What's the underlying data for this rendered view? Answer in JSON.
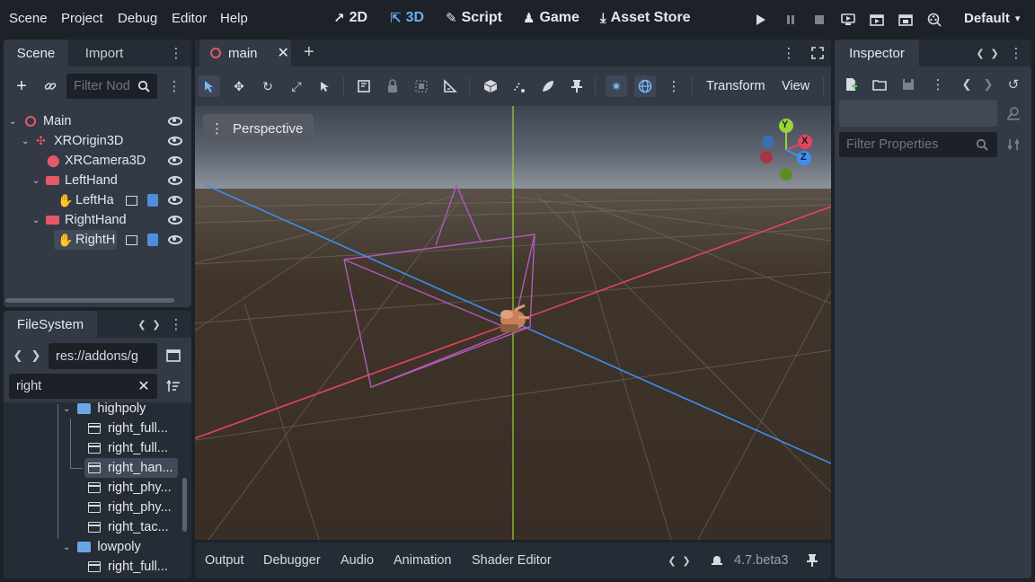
{
  "menubar": {
    "items": [
      "Scene",
      "Project",
      "Debug",
      "Editor",
      "Help"
    ],
    "workspaces": [
      {
        "label": "2D",
        "icon": "2d-icon"
      },
      {
        "label": "3D",
        "icon": "3d-icon"
      },
      {
        "label": "Script",
        "icon": "script-icon"
      },
      {
        "label": "Game",
        "icon": "game-icon"
      },
      {
        "label": "Asset Store",
        "icon": "asset-store-icon"
      }
    ],
    "layout_label": "Default"
  },
  "scene_dock": {
    "tabs": [
      "Scene",
      "Import"
    ],
    "filter_placeholder": "Filter Nod",
    "tree": [
      {
        "label": "Main",
        "icon": "node3d-icon",
        "color": "#e5586a"
      },
      {
        "label": "XROrigin3D",
        "icon": "xr-origin-icon",
        "color": "#e5586a"
      },
      {
        "label": "XRCamera3D",
        "icon": "xr-camera-icon",
        "color": "#e5586a"
      },
      {
        "label": "LeftHand",
        "icon": "xr-controller-icon",
        "color": "#e5586a"
      },
      {
        "label": "LeftHa",
        "icon": "hand-icon",
        "color": "#e5586a"
      },
      {
        "label": "RightHand",
        "icon": "xr-controller-icon",
        "color": "#e5586a"
      },
      {
        "label": "RightH",
        "icon": "hand-icon",
        "color": "#e5586a"
      }
    ]
  },
  "filesystem": {
    "tab": "FileSystem",
    "path": "res://addons/g",
    "search": "right",
    "items": [
      {
        "label": "highpoly",
        "type": "folder"
      },
      {
        "label": "right_full...",
        "type": "scene"
      },
      {
        "label": "right_full...",
        "type": "scene"
      },
      {
        "label": "right_han...",
        "type": "scene",
        "selected": true
      },
      {
        "label": "right_phy...",
        "type": "scene"
      },
      {
        "label": "right_phy...",
        "type": "scene"
      },
      {
        "label": "right_tac...",
        "type": "scene"
      },
      {
        "label": "lowpoly",
        "type": "folder"
      },
      {
        "label": "right_full...",
        "type": "scene"
      }
    ]
  },
  "editor_tabs": {
    "current": "main",
    "add_label": "+"
  },
  "viewport_toolbar": {
    "transform_label": "Transform",
    "view_label": "View"
  },
  "viewport": {
    "perspective_label": "Perspective",
    "gizmo_labels": {
      "x": "X",
      "y": "Y",
      "z": "Z"
    },
    "colors": {
      "x_axis": "#e5445e",
      "y_axis": "#9ad435",
      "z_axis": "#3d8ef0",
      "frustum": "#b25ab8"
    }
  },
  "bottom_panel": {
    "tabs": [
      "Output",
      "Debugger",
      "Audio",
      "Animation",
      "Shader Editor"
    ],
    "version": "4.7.beta3"
  },
  "inspector": {
    "tab": "Inspector",
    "filter_placeholder": "Filter Properties"
  }
}
